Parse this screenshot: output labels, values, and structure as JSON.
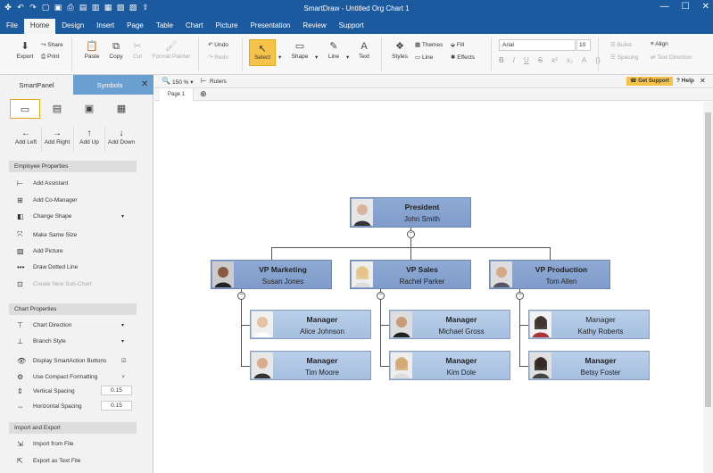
{
  "window": {
    "title": "SmartDraw - Untitled Org Chart 1",
    "controls": [
      "—",
      "☐",
      "✕"
    ]
  },
  "menu": [
    "File",
    "Home",
    "Design",
    "Insert",
    "Page",
    "Table",
    "Chart",
    "Picture",
    "Presentation",
    "Review",
    "Support"
  ],
  "ribbon": {
    "export": "Export",
    "share": "Share",
    "print": "Print",
    "paste": "Paste",
    "copy": "Copy",
    "cut": "Cut",
    "format_painter": "Format Painter",
    "undo": "Undo",
    "redo": "Redo",
    "select": "Select",
    "shape": "Shape",
    "line": "Line",
    "text": "Text",
    "styles": "Styles",
    "themes": "Themes",
    "line2": "Line",
    "fill": "Fill",
    "effects": "Effects",
    "font": "Arial",
    "size": "10",
    "bullet": "Bullet",
    "spacing": "Spacing",
    "align": "Align",
    "text_direction": "Text Direction"
  },
  "panel": {
    "tab_smartpanel": "SmartPanel",
    "tab_symbols": "Symbols",
    "add_left": "Add Left",
    "add_right": "Add Right",
    "add_up": "Add Up",
    "add_down": "Add Down",
    "employee_header": "Employee Properties",
    "employee_items": [
      "Add Assistant",
      "Add Co-Manager",
      "Change Shape",
      "Make Same Size",
      "Add Picture",
      "Draw Dotted Line",
      "Create New Sub-Chart"
    ],
    "chart_header": "Chart Properties",
    "chart_items": [
      "Chart Direction",
      "Branch Style",
      "Display SmartAction Buttons",
      "Use Compact Formatting",
      "Vertical Spacing",
      "Horizontal Spacing"
    ],
    "vertical_spacing": "0.15",
    "horizontal_spacing": "0.15",
    "io_header": "Import and Export",
    "io_items": [
      "Import from File",
      "Export as Text File"
    ]
  },
  "canvas": {
    "zoom": "150 %",
    "rulers": "Rulers",
    "page_tab": "Page 1",
    "get_support": "Get Support",
    "help": "Help"
  },
  "org": {
    "president": {
      "title": "President",
      "name": "John Smith"
    },
    "vps": [
      {
        "title": "VP Marketing",
        "name": "Susan Jones"
      },
      {
        "title": "VP Sales",
        "name": "Rachel Parker"
      },
      {
        "title": "VP Production",
        "name": "Tom Allen"
      }
    ],
    "managers": [
      {
        "title": "Manager",
        "name": "Alice Johnson"
      },
      {
        "title": "Manager",
        "name": "Tim Moore"
      },
      {
        "title": "Manager",
        "name": "Michael Gross"
      },
      {
        "title": "Manager",
        "name": "Kim Dole"
      },
      {
        "title": "Manager",
        "name": "Kathy Roberts"
      },
      {
        "title": "Manager",
        "name": "Betsy Foster"
      }
    ]
  },
  "colors": {
    "titlebar": "#1c5aa0",
    "accent": "#f6c34a",
    "box": "#a6bfe0",
    "box_top": "#7f9ccb"
  }
}
